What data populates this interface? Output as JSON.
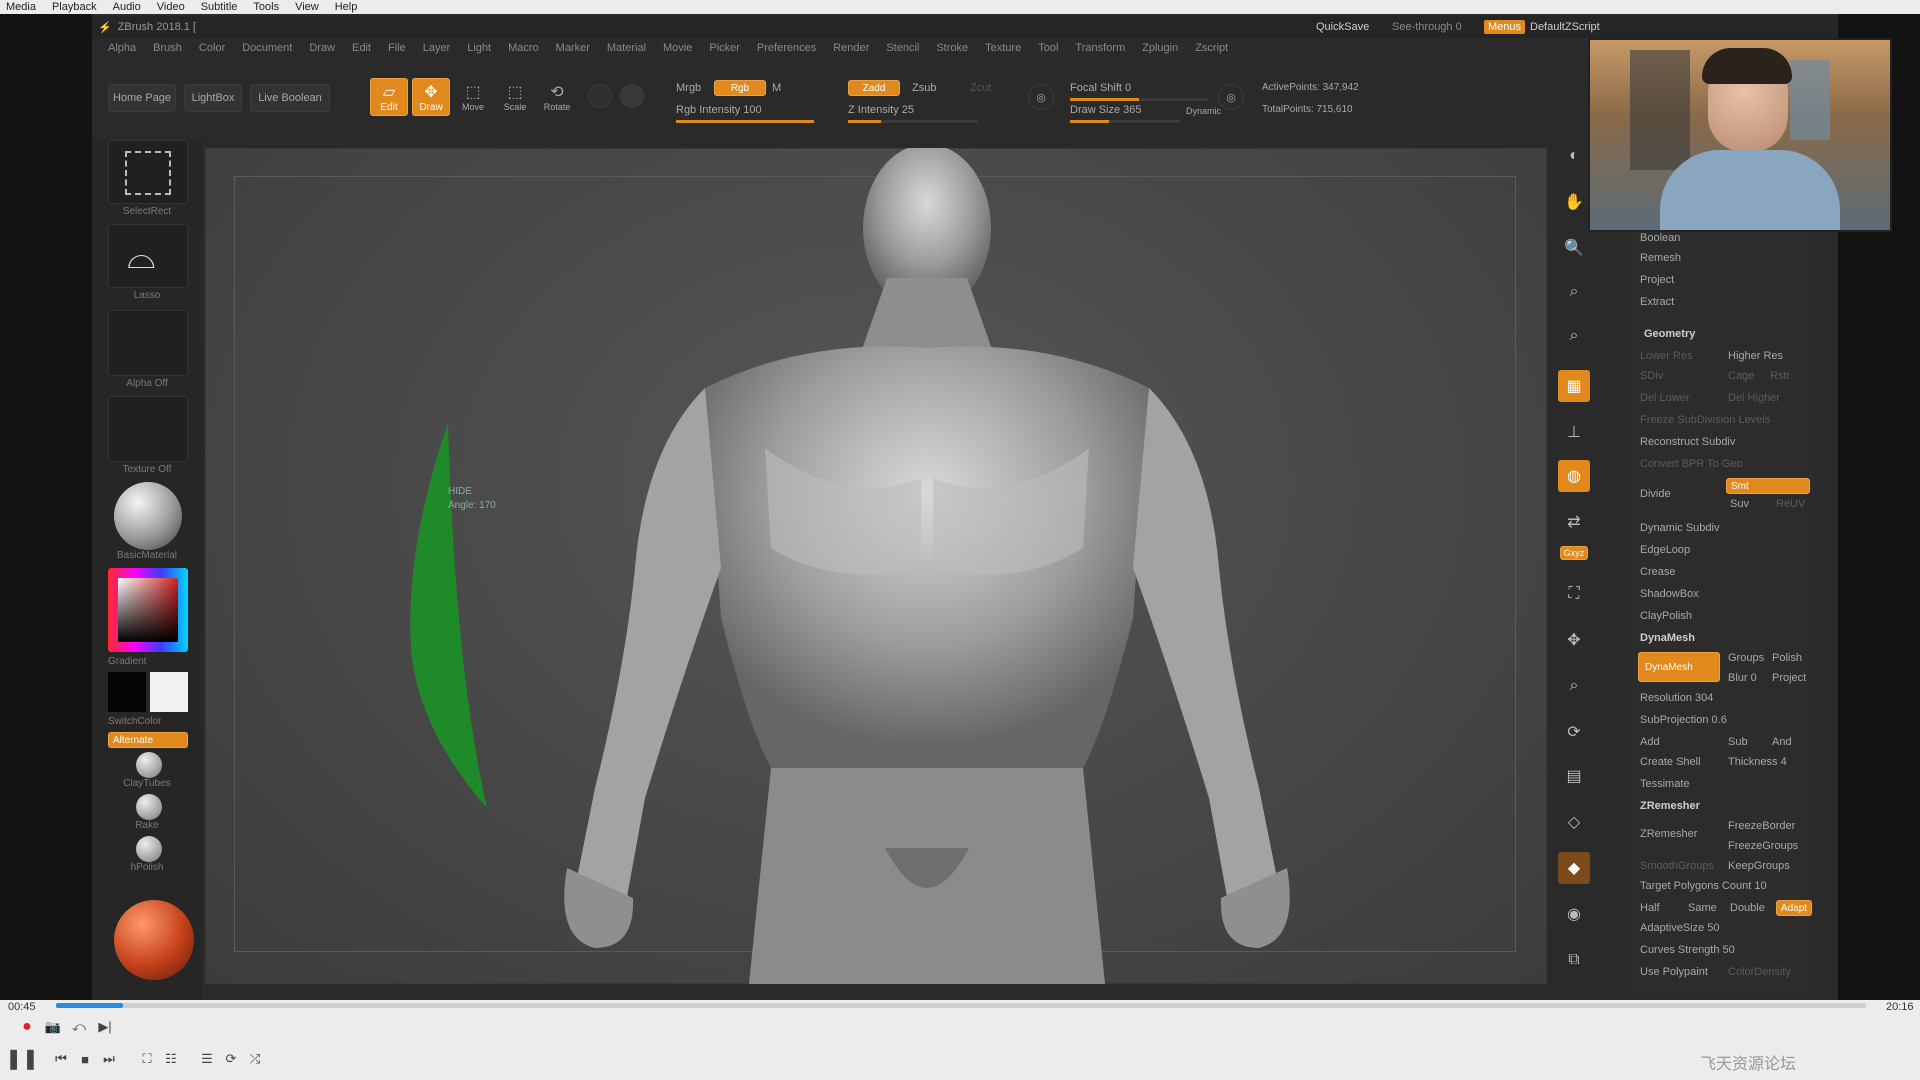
{
  "vlc": {
    "menu": [
      "Media",
      "Playback",
      "Audio",
      "Video",
      "Subtitle",
      "Tools",
      "View",
      "Help"
    ],
    "time_elapsed": "00:45",
    "time_total": "20:16",
    "progress": 0.037,
    "watermark": "飞天资源论坛"
  },
  "zbrush": {
    "title": "ZBrush 2018.1 [",
    "title_right": {
      "quicksave": "QuickSave",
      "see_through": "See-through 0",
      "menus": "Menus",
      "script": "DefaultZScript"
    },
    "menu": [
      "Alpha",
      "Brush",
      "Color",
      "Document",
      "Draw",
      "Edit",
      "File",
      "Layer",
      "Light",
      "Macro",
      "Marker",
      "Material",
      "Movie",
      "Picker",
      "Preferences",
      "Render",
      "Stencil",
      "Stroke",
      "Texture",
      "Tool",
      "Transform",
      "Zplugin",
      "Zscript"
    ],
    "shelf": {
      "home_page": "Home Page",
      "lightbox": "LightBox",
      "live_boolean": "Live Boolean",
      "edit": "Edit",
      "draw": "Draw",
      "move": "Move",
      "scale": "Scale",
      "rotate": "Rotate",
      "mrgb": "Mrgb",
      "rgb": "Rgb",
      "m": "M",
      "zadd": "Zadd",
      "zsub": "Zsub",
      "zcut": "Zcut",
      "rgb_intensity": "Rgb Intensity 100",
      "z_intensity": "Z Intensity 25",
      "focal_shift": "Focal Shift 0",
      "draw_size": "Draw Size 365",
      "dynamic": "Dynamic",
      "active_points": "ActivePoints: 347,942",
      "total_points": "TotalPoints: 715,610",
      "z_intensity_level": 0.25,
      "rgb_intensity_level": 1.0,
      "draw_size_level": 0.35
    },
    "left": {
      "select_rect": "SelectRect",
      "lasso": "Lasso",
      "alpha_off": "Alpha Off",
      "texture_off": "Texture Off",
      "material": "BasicMaterial",
      "gradient": "Gradient",
      "switch_color": "SwitchColor",
      "alternate": "Alternate",
      "brushes": [
        "ClayTubes",
        "Rake",
        "hPolish"
      ]
    },
    "canvas": {
      "gizmo_label_1": "HIDE",
      "gizmo_label_2": "Angle: 170"
    },
    "right_tools": [
      "SPix",
      "Scroll",
      "Zoom",
      "Actual",
      "AAHalf",
      "Persp",
      "Floor",
      "Local",
      "L.Sym",
      "Gxyz",
      "Frame",
      "Move",
      "Zoom3D",
      "Rotate",
      "Line Fill",
      "Transp",
      "Ghost",
      "Solo",
      "Xpose"
    ],
    "palette": {
      "items_top": [
        "Boolean",
        "Remesh",
        "Project",
        "Extract"
      ],
      "geometry_header": "Geometry",
      "lower_res": "Lower Res",
      "higher_res": "Higher Res",
      "sdiv": "SDiv",
      "cage": "Cage",
      "rstr": "Rstr",
      "del_lower": "Del Lower",
      "del_higher": "Del Higher",
      "freeze_subdiv": "Freeze SubDivision Levels",
      "reconstruct_subdiv": "Reconstruct Subdiv",
      "convert_bpr": "Convert BPR To Geo",
      "divide": "Divide",
      "smt": "Smt",
      "suv": "Suv",
      "relax": "ReUV",
      "dynamic_subdiv": "Dynamic Subdiv",
      "edgeloop": "EdgeLoop",
      "crease": "Crease",
      "shadowbox": "ShadowBox",
      "claypolish": "ClayPolish",
      "dynamesh_header": "DynaMesh",
      "dynamesh_btn": "DynaMesh",
      "groups": "Groups",
      "polish": "Polish",
      "blur": "Blur 0",
      "project": "Project",
      "resolution": "Resolution 304",
      "subprojection": "SubProjection 0.6",
      "add": "Add",
      "sub": "Sub",
      "and": "And",
      "create_shell": "Create Shell",
      "thickness": "Thickness 4",
      "tessimate": "Tessimate",
      "zremesher_header": "ZRemesher",
      "zremesher_btn": "ZRemesher",
      "freeze_border": "FreezeBorder",
      "freeze_groups": "FreezeGroups",
      "smooth_groups": "SmoothGroups",
      "keep_groups": "KeepGroups",
      "target_poly": "Target Polygons Count 10",
      "half": "Half",
      "same": "Same",
      "double": "Double",
      "adapt": "Adapt",
      "adaptive_size": "AdaptiveSize 50",
      "curves_strength": "Curves Strength 50",
      "use_polypaint": "Use Polypaint",
      "color_density": "ColorDensity"
    }
  },
  "colors": {
    "accent": "#e08a1e",
    "vlc_blue": "#2a8ce0",
    "gizmo_green": "#1f8a2a"
  }
}
